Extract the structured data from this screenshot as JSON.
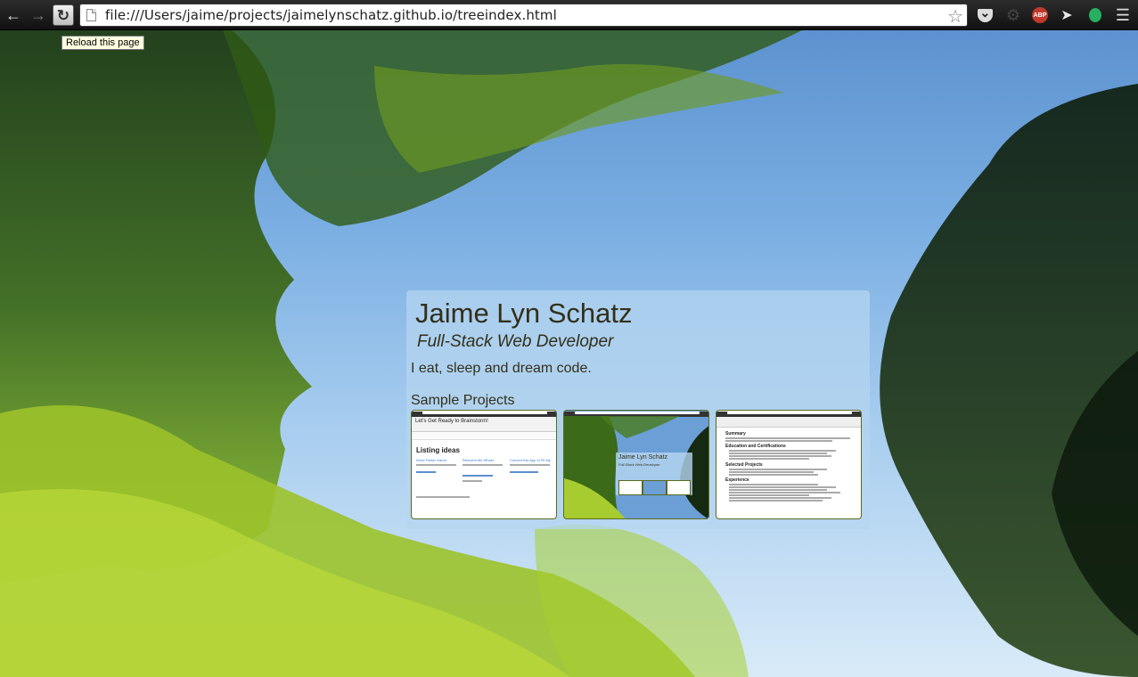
{
  "browser": {
    "url": "file:///Users/jaime/projects/jaimelynschatz.github.io/treeindex.html",
    "reload_tooltip": "Reload this page",
    "icons": {
      "back": "back-arrow-icon",
      "forward": "forward-arrow-icon",
      "reload": "reload-icon",
      "page": "page-icon",
      "bookmark": "star-icon",
      "extensions": [
        "pocket-icon",
        "gear-icon",
        "adblock-icon",
        "rocket-icon",
        "balloon-icon",
        "menu-icon"
      ]
    },
    "abp_label": "ABP"
  },
  "profile": {
    "name": "Jaime Lyn Schatz",
    "role": "Full-Stack Web Developer",
    "tagline": "I eat, sleep and dream code.",
    "projects_heading": "Sample Projects"
  },
  "projects": [
    {
      "header": "Let's Get Ready to Brainstorm!",
      "heading": "Listing ideas",
      "columns": [
        "Word Finder Game",
        "Reinvent the Wheel",
        "Convert this App to Fit My List"
      ]
    },
    {
      "name": "Jaime Lyn Schatz",
      "role": "Full-Stack Web Developer"
    },
    {
      "sections": [
        "Summary",
        "Education and Certifications",
        "Selected Projects",
        "Experience"
      ]
    }
  ],
  "colors": {
    "text": "#332f1a",
    "card": "#b5d6f0",
    "thumb_border": "#5a6b1f"
  }
}
